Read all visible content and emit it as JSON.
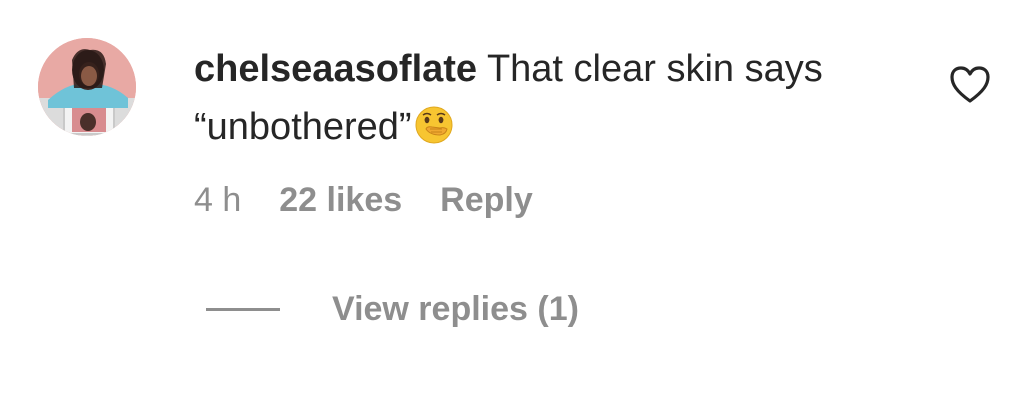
{
  "comment": {
    "username": "chelseaasoflate",
    "text": "That clear skin says “unbothered”",
    "emoji": "hand-over-mouth-emoji",
    "time": "4 h",
    "likes": "22 likes",
    "reply_label": "Reply",
    "view_replies_label": "View replies (1)"
  },
  "icons": {
    "like": "heart-icon",
    "avatar": "avatar"
  },
  "colors": {
    "text": "#262626",
    "secondary": "#8e8e8e",
    "avatar_bg": "#e8a9a4"
  }
}
